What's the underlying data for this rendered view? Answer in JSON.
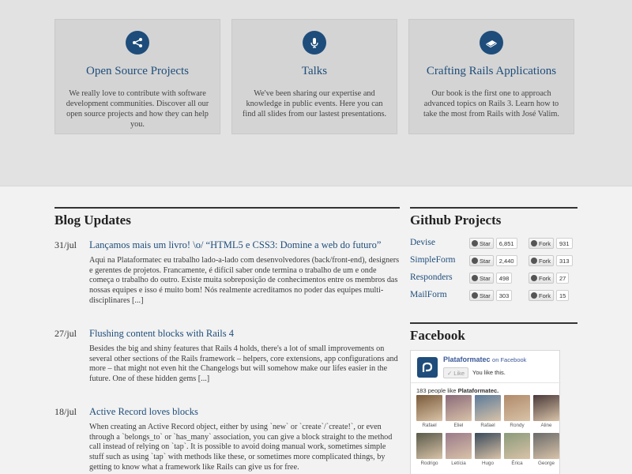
{
  "features": [
    {
      "title": "Open Source Projects",
      "text": "We really love to contribute with software development communities. Discover all our open source projects and how they can help you.",
      "icon": "share-icon"
    },
    {
      "title": "Talks",
      "text": "We've been sharing our expertise and knowledge in public events. Here you can find all slides from our lastest presentations.",
      "icon": "microphone-icon"
    },
    {
      "title": "Crafting Rails Applications",
      "text": "Our book is the first one to approach advanced topics on Rails 3. Learn how to take the most from Rails with José Valim.",
      "icon": "book-icon"
    }
  ],
  "blog": {
    "heading": "Blog Updates",
    "posts": [
      {
        "date": "31/jul",
        "title": "Lançamos mais um livro! \\o/ “HTML5 e CSS3: Domine a web do futuro”",
        "excerpt": "Aqui na Plataformatec eu trabalho lado-a-lado com desenvolvedores (back/front-end), designers e gerentes de projetos. Francamente, é difícil saber onde termina o trabalho de um e onde começa o trabalho do outro. Existe muita sobreposição de conhecimentos entre os membros das nossas equipes e isso é muito bom! Nós realmente acreditamos no poder das equipes multi-disciplinares [...]"
      },
      {
        "date": "27/jul",
        "title": "Flushing content blocks with Rails 4",
        "excerpt": "Besides the big and shiny features that Rails 4 holds, there's a lot of small improvements on several other sections of the Rails framework – helpers, core extensions, app configurations and more – that might not even hit the Changelogs but will somehow make our lifes easier in the future. One of these hidden gems [...]"
      },
      {
        "date": "18/jul",
        "title": "Active Record loves blocks",
        "excerpt": "When creating an Active Record object, either by using `new` or `create`/`create!`, or even through a `belongs_to` or `has_many` association, you can give a block straight to the method call instead of relying on `tap`. It is possible to avoid doing manual work, sometimes simple stuff such as using `tap` with methods like these, or sometimes more complicated things, by getting to know what a framework like Rails can give us for free."
      }
    ]
  },
  "github": {
    "heading": "Github Projects",
    "star_label": "Star",
    "fork_label": "Fork",
    "repos": [
      {
        "name": "Devise",
        "stars": "6,851",
        "forks": "931"
      },
      {
        "name": "SimpleForm",
        "stars": "2,440",
        "forks": "313"
      },
      {
        "name": "Responders",
        "stars": "498",
        "forks": "27"
      },
      {
        "name": "MailForm",
        "stars": "303",
        "forks": "15"
      }
    ]
  },
  "facebook": {
    "heading": "Facebook",
    "page_name": "Plataformatec",
    "on_facebook": "on Facebook",
    "like_label": "Like",
    "you_like": "You like this.",
    "count_text": "183 people like",
    "count_page": "Plataformatec.",
    "fans": [
      {
        "name": "Rafael",
        "color": "#7a5a3a"
      },
      {
        "name": "Eliel",
        "color": "#8a6a7a"
      },
      {
        "name": "Rafael",
        "color": "#5a7a9a"
      },
      {
        "name": "Rondy",
        "color": "#b08a6a"
      },
      {
        "name": "Aline",
        "color": "#4a3a3a"
      },
      {
        "name": "Rodrigo",
        "color": "#5a5a4a"
      },
      {
        "name": "Letícia",
        "color": "#9a7a8a"
      },
      {
        "name": "Hugo",
        "color": "#3a4a5a"
      },
      {
        "name": "Érica",
        "color": "#8a9a7a"
      },
      {
        "name": "George",
        "color": "#6a6a6a"
      }
    ]
  }
}
